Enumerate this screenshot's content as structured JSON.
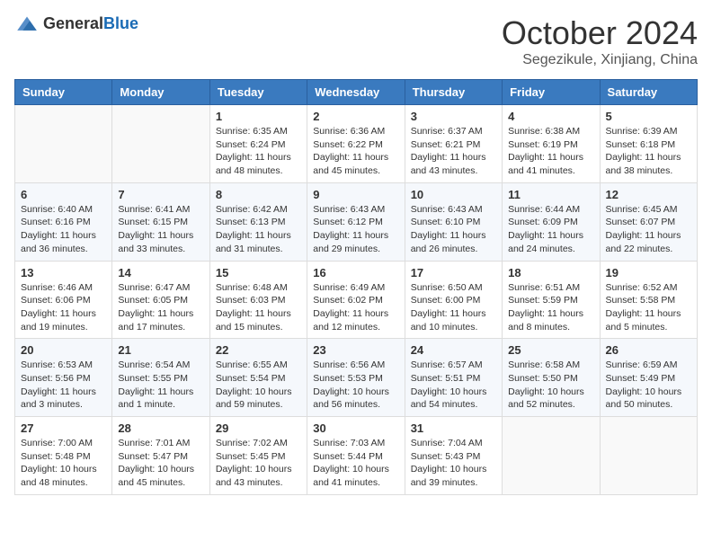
{
  "header": {
    "logo_general": "General",
    "logo_blue": "Blue",
    "month_year": "October 2024",
    "location": "Segezikule, Xinjiang, China"
  },
  "days_of_week": [
    "Sunday",
    "Monday",
    "Tuesday",
    "Wednesday",
    "Thursday",
    "Friday",
    "Saturday"
  ],
  "weeks": [
    [
      {
        "day": "",
        "info": ""
      },
      {
        "day": "",
        "info": ""
      },
      {
        "day": "1",
        "info": "Sunrise: 6:35 AM\nSunset: 6:24 PM\nDaylight: 11 hours and 48 minutes."
      },
      {
        "day": "2",
        "info": "Sunrise: 6:36 AM\nSunset: 6:22 PM\nDaylight: 11 hours and 45 minutes."
      },
      {
        "day": "3",
        "info": "Sunrise: 6:37 AM\nSunset: 6:21 PM\nDaylight: 11 hours and 43 minutes."
      },
      {
        "day": "4",
        "info": "Sunrise: 6:38 AM\nSunset: 6:19 PM\nDaylight: 11 hours and 41 minutes."
      },
      {
        "day": "5",
        "info": "Sunrise: 6:39 AM\nSunset: 6:18 PM\nDaylight: 11 hours and 38 minutes."
      }
    ],
    [
      {
        "day": "6",
        "info": "Sunrise: 6:40 AM\nSunset: 6:16 PM\nDaylight: 11 hours and 36 minutes."
      },
      {
        "day": "7",
        "info": "Sunrise: 6:41 AM\nSunset: 6:15 PM\nDaylight: 11 hours and 33 minutes."
      },
      {
        "day": "8",
        "info": "Sunrise: 6:42 AM\nSunset: 6:13 PM\nDaylight: 11 hours and 31 minutes."
      },
      {
        "day": "9",
        "info": "Sunrise: 6:43 AM\nSunset: 6:12 PM\nDaylight: 11 hours and 29 minutes."
      },
      {
        "day": "10",
        "info": "Sunrise: 6:43 AM\nSunset: 6:10 PM\nDaylight: 11 hours and 26 minutes."
      },
      {
        "day": "11",
        "info": "Sunrise: 6:44 AM\nSunset: 6:09 PM\nDaylight: 11 hours and 24 minutes."
      },
      {
        "day": "12",
        "info": "Sunrise: 6:45 AM\nSunset: 6:07 PM\nDaylight: 11 hours and 22 minutes."
      }
    ],
    [
      {
        "day": "13",
        "info": "Sunrise: 6:46 AM\nSunset: 6:06 PM\nDaylight: 11 hours and 19 minutes."
      },
      {
        "day": "14",
        "info": "Sunrise: 6:47 AM\nSunset: 6:05 PM\nDaylight: 11 hours and 17 minutes."
      },
      {
        "day": "15",
        "info": "Sunrise: 6:48 AM\nSunset: 6:03 PM\nDaylight: 11 hours and 15 minutes."
      },
      {
        "day": "16",
        "info": "Sunrise: 6:49 AM\nSunset: 6:02 PM\nDaylight: 11 hours and 12 minutes."
      },
      {
        "day": "17",
        "info": "Sunrise: 6:50 AM\nSunset: 6:00 PM\nDaylight: 11 hours and 10 minutes."
      },
      {
        "day": "18",
        "info": "Sunrise: 6:51 AM\nSunset: 5:59 PM\nDaylight: 11 hours and 8 minutes."
      },
      {
        "day": "19",
        "info": "Sunrise: 6:52 AM\nSunset: 5:58 PM\nDaylight: 11 hours and 5 minutes."
      }
    ],
    [
      {
        "day": "20",
        "info": "Sunrise: 6:53 AM\nSunset: 5:56 PM\nDaylight: 11 hours and 3 minutes."
      },
      {
        "day": "21",
        "info": "Sunrise: 6:54 AM\nSunset: 5:55 PM\nDaylight: 11 hours and 1 minute."
      },
      {
        "day": "22",
        "info": "Sunrise: 6:55 AM\nSunset: 5:54 PM\nDaylight: 10 hours and 59 minutes."
      },
      {
        "day": "23",
        "info": "Sunrise: 6:56 AM\nSunset: 5:53 PM\nDaylight: 10 hours and 56 minutes."
      },
      {
        "day": "24",
        "info": "Sunrise: 6:57 AM\nSunset: 5:51 PM\nDaylight: 10 hours and 54 minutes."
      },
      {
        "day": "25",
        "info": "Sunrise: 6:58 AM\nSunset: 5:50 PM\nDaylight: 10 hours and 52 minutes."
      },
      {
        "day": "26",
        "info": "Sunrise: 6:59 AM\nSunset: 5:49 PM\nDaylight: 10 hours and 50 minutes."
      }
    ],
    [
      {
        "day": "27",
        "info": "Sunrise: 7:00 AM\nSunset: 5:48 PM\nDaylight: 10 hours and 48 minutes."
      },
      {
        "day": "28",
        "info": "Sunrise: 7:01 AM\nSunset: 5:47 PM\nDaylight: 10 hours and 45 minutes."
      },
      {
        "day": "29",
        "info": "Sunrise: 7:02 AM\nSunset: 5:45 PM\nDaylight: 10 hours and 43 minutes."
      },
      {
        "day": "30",
        "info": "Sunrise: 7:03 AM\nSunset: 5:44 PM\nDaylight: 10 hours and 41 minutes."
      },
      {
        "day": "31",
        "info": "Sunrise: 7:04 AM\nSunset: 5:43 PM\nDaylight: 10 hours and 39 minutes."
      },
      {
        "day": "",
        "info": ""
      },
      {
        "day": "",
        "info": ""
      }
    ]
  ]
}
